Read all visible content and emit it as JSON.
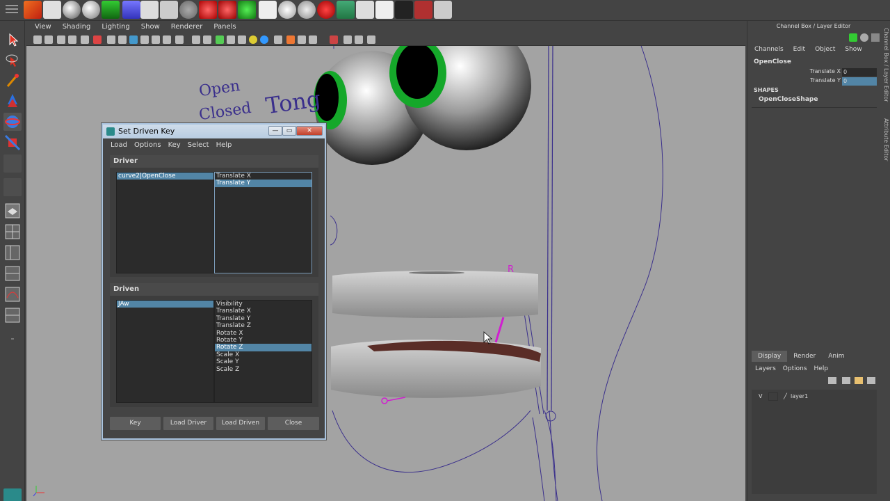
{
  "viewport": {
    "menu": [
      "View",
      "Shading",
      "Lighting",
      "Show",
      "Renderer",
      "Panels"
    ],
    "scene_labels": [
      "Open",
      "Closed",
      "Tong"
    ]
  },
  "dialog": {
    "title": "Set Driven Key",
    "menu": [
      "Load",
      "Options",
      "Key",
      "Select",
      "Help"
    ],
    "driver": {
      "header": "Driver",
      "objects": [
        {
          "label": "curve2|OpenClose",
          "selected": true
        }
      ],
      "attributes": [
        {
          "label": "Translate X",
          "selected": false
        },
        {
          "label": "Translate Y",
          "selected": true
        }
      ]
    },
    "driven": {
      "header": "Driven",
      "objects": [
        {
          "label": "JAw",
          "selected": true
        }
      ],
      "attributes": [
        {
          "label": "Visibility",
          "selected": false
        },
        {
          "label": "Translate X",
          "selected": false
        },
        {
          "label": "Translate Y",
          "selected": false
        },
        {
          "label": "Translate Z",
          "selected": false
        },
        {
          "label": "Rotate X",
          "selected": false
        },
        {
          "label": "Rotate Y",
          "selected": false
        },
        {
          "label": "Rotate Z",
          "selected": true
        },
        {
          "label": "Scale X",
          "selected": false
        },
        {
          "label": "Scale Y",
          "selected": false
        },
        {
          "label": "Scale Z",
          "selected": false
        }
      ]
    },
    "buttons": {
      "key": "Key",
      "load_driver": "Load Driver",
      "load_driven": "Load Driven",
      "close": "Close"
    }
  },
  "channel_box": {
    "title": "Channel Box / Layer Editor",
    "menu": [
      "Channels",
      "Edit",
      "Object",
      "Show"
    ],
    "node": "OpenClose",
    "attributes": [
      {
        "name": "Translate X",
        "value": "0",
        "selected": false
      },
      {
        "name": "Translate Y",
        "value": "0",
        "selected": true
      }
    ],
    "shapes_header": "SHAPES",
    "shape_name": "OpenCloseShape",
    "side_tabs": [
      "Channel Box / Layer Editor",
      "Attribute Editor"
    ]
  },
  "layer_editor": {
    "tabs": [
      "Display",
      "Render",
      "Anim"
    ],
    "active_tab": "Display",
    "menu": [
      "Layers",
      "Options",
      "Help"
    ],
    "layers": [
      {
        "visible": "V",
        "name": "layer1"
      }
    ]
  },
  "colors": {
    "viewport_bg": "#a3a3a3",
    "selection": "#5285a6",
    "wire": "#3a2f8c",
    "joint": "#d01fd0"
  }
}
